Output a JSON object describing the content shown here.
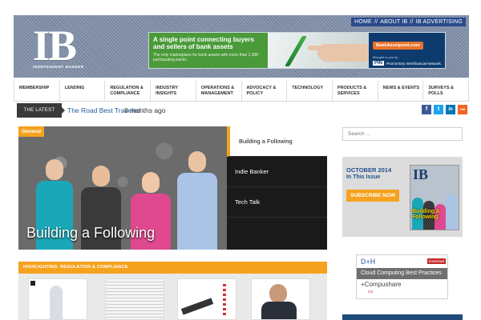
{
  "header": {
    "top_links": [
      "HOME",
      "ABOUT IB",
      "IB ADVERTISING"
    ],
    "logo_text": "IB",
    "logo_subtitle": "INDEPENDENT BANKER",
    "ad": {
      "headline": "A single point connecting buyers and sellers of bank assets",
      "subline": "The only marketplace for bank assets with more than 1,300 participating banks.",
      "button": "BankAssetpoint.com",
      "brought_by": "Brought to you by",
      "partner_mark": "PIN",
      "partner_name": "Promontory Interfinancial Network."
    }
  },
  "nav": {
    "items": [
      "MEMBERSHIP",
      "LENDING",
      "REGULATION & COMPLIANCE",
      "INDUSTRY INSIGHTS",
      "OPERATIONS & MANAGEMENT",
      "ADVOCACY & POLICY",
      "TECHNOLOGY",
      "PRODUCTS & SERVICES",
      "NEWS & EVENTS",
      "SURVEYS & POLLS"
    ]
  },
  "ticker": {
    "label": "THE LATEST",
    "title": "The Road Best Traveled",
    "time": "8 months ago"
  },
  "social": [
    "f",
    "t",
    "in",
    "rss"
  ],
  "featured": {
    "tag": "General",
    "caption": "Building a Following",
    "list": [
      "Building a Following",
      "Indie Banker",
      "Tech Talk"
    ]
  },
  "highlight": {
    "label": "HIGHLIGHTING: REGULATION & COMPLIANCE"
  },
  "sidebar": {
    "search_placeholder": "Search ...",
    "issue_month": "OCTOBER 2014",
    "issue_this": "In This Issue",
    "subscribe": "SUBSCRIBE NOW",
    "cover_logo": "IB",
    "cover_title": "Building A Following",
    "ad2": {
      "logo": "D+H",
      "tag": "download",
      "headline": "Cloud Computing Best Practices",
      "brand": "+Compushare",
      "brand_sub": "CS"
    }
  },
  "colors": {
    "accent": "#f5a21f",
    "link": "#1f5a96",
    "header_blue": "#2a4a8a"
  }
}
